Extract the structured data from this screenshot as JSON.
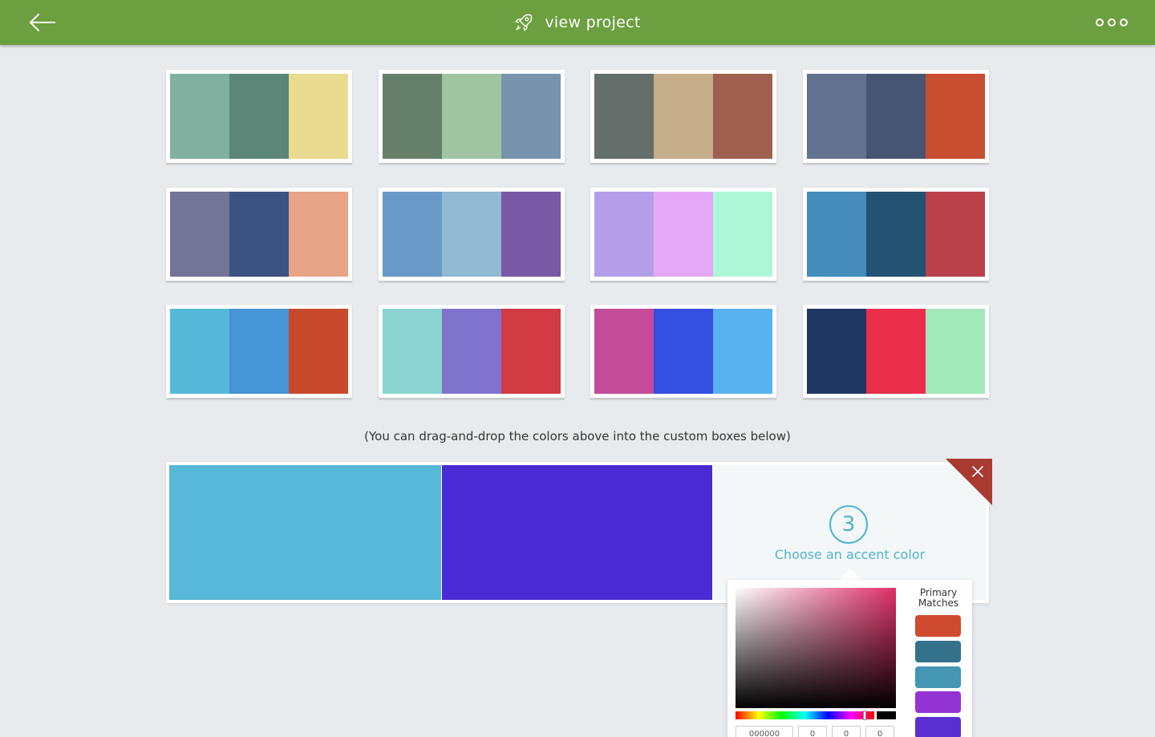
{
  "header": {
    "title": "view project",
    "bg_color": "#6c9f3f",
    "back_icon": "arrow-left-icon",
    "title_icon": "rocket-icon",
    "more_icon": "more-horizontal-icon"
  },
  "palettes": [
    [
      "#80b0a0",
      "#5c8677",
      "#e9db8f"
    ],
    [
      "#667f6a",
      "#a0c4a2",
      "#7893ad"
    ],
    [
      "#646e6a",
      "#c5ad8b",
      "#a06050"
    ],
    [
      "#62728f",
      "#465672",
      "#c74e30"
    ],
    [
      "#737498",
      "#3b5382",
      "#e8a486"
    ],
    [
      "#6999c6",
      "#91b9d1",
      "#7759a5"
    ],
    [
      "#b39fe9",
      "#e5a8f6",
      "#aef6d8"
    ],
    [
      "#458cbb",
      "#235273",
      "#ba414c"
    ],
    [
      "#55b8d8",
      "#4494d6",
      "#c84a2d"
    ],
    [
      "#8ad3d0",
      "#7f73cd",
      "#d23a44"
    ],
    [
      "#c44b97",
      "#344ee0",
      "#58b2ef"
    ],
    [
      "#213763",
      "#eb2f4b",
      "#a2e8b9"
    ]
  ],
  "hint": "(You can drag-and-drop the colors above into the custom boxes below)",
  "custom": {
    "box1_color": "#58b8d9",
    "box2_color": "#4a2bd3",
    "step_number": "3",
    "step_label": "Choose an accent color",
    "close_icon": "close-icon",
    "close_color": "#a83a30"
  },
  "picker": {
    "hex_value": "000000",
    "r_value": "0",
    "g_value": "0",
    "b_value": "0",
    "matches_label": "Primary Matches",
    "matches": [
      "#cf4a2f",
      "#34728b",
      "#4496b2",
      "#9333d3",
      "#5a2fd2"
    ]
  }
}
